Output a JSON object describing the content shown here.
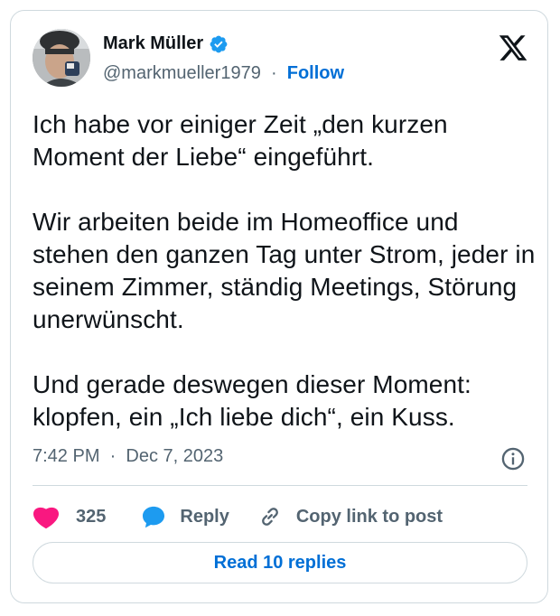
{
  "author": {
    "name": "Mark Müller",
    "handle": "@markmueller1979",
    "separator": "·",
    "follow_label": "Follow"
  },
  "tweet": {
    "text": "Ich habe vor einiger Zeit „den kurzen Moment der Liebe“ eingeführt.\n\nWir arbeiten beide im Homeoffice und stehen den ganzen Tag unter Strom, jeder in seinem Zimmer, ständig Meetings, Störung unerwünscht.\n\nUnd gerade deswegen dieser Moment: klopfen, ein „Ich liebe dich“, ein Kuss.",
    "time": "7:42 PM",
    "date": "Dec 7, 2023",
    "meta_separator": "·"
  },
  "actions": {
    "like_count": "325",
    "reply_label": "Reply",
    "copy_link_label": "Copy link to post"
  },
  "read_replies_label": "Read 10 replies",
  "colors": {
    "accent": "#006fd6",
    "verified": "#1d9bf0",
    "like": "#f91880",
    "reply_bubble": "#1d9bf0",
    "secondary_text": "#536471",
    "border": "#cfd9de"
  },
  "icons": {
    "brand": "x-logo-icon",
    "verified": "verified-badge-icon",
    "info": "info-icon",
    "like": "heart-icon",
    "reply": "speech-bubble-icon",
    "copy_link": "link-icon"
  }
}
